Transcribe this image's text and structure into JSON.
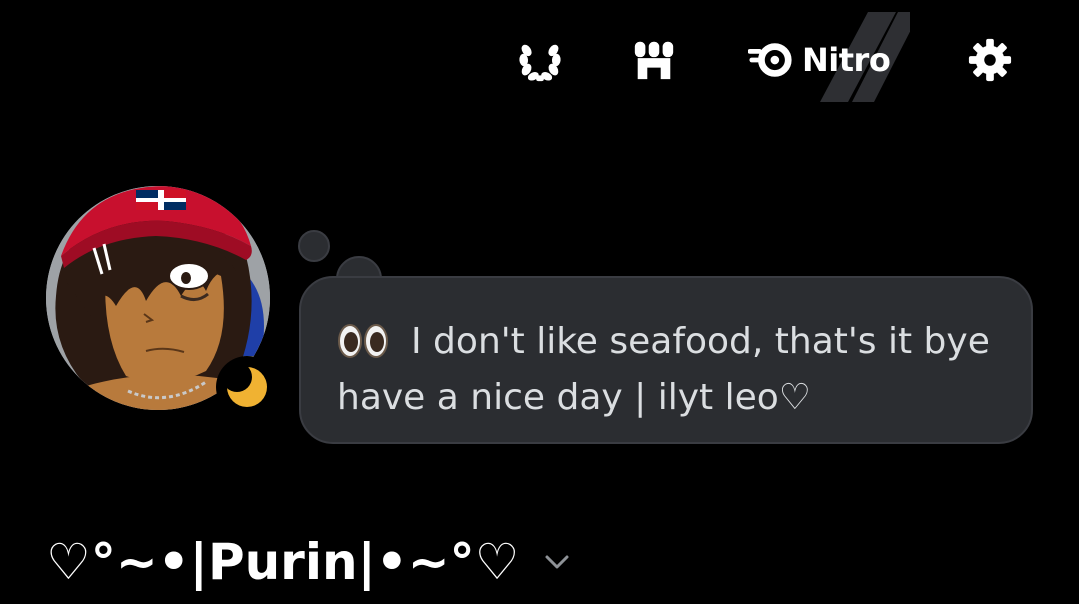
{
  "header": {
    "nitro_label": "Nitro",
    "icons": [
      "quests-laurel-icon",
      "shop-icon",
      "nitro-icon",
      "settings-gear-icon"
    ]
  },
  "profile": {
    "online_status": "idle",
    "custom_status": {
      "emoji": "👀",
      "emoji_name": "eyes-emoji",
      "text": "I don't like seafood, that's it bye have a nice day | ilyt leo♡"
    },
    "display_name": "♡°~•|Purin|•~°♡"
  },
  "colors": {
    "background": "#000000",
    "bubble": "#2b2d31",
    "bubble_border": "#3a3c42",
    "status_text": "#dbdee1",
    "idle": "#f0b232",
    "avatar_bg": "#9ea2a6"
  }
}
